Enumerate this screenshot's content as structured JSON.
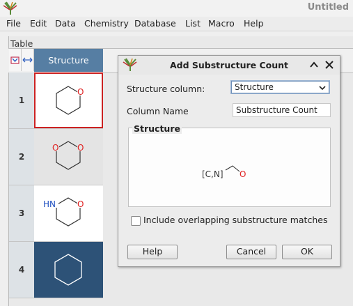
{
  "window": {
    "title": "Untitled"
  },
  "menu": [
    "File",
    "Edit",
    "Data",
    "Chemistry",
    "Database",
    "List",
    "Macro",
    "Help"
  ],
  "table": {
    "caption": "Table",
    "column_header": "Structure",
    "rows": [
      {
        "number": "1",
        "structure": "tetrahydropyran",
        "selected": true
      },
      {
        "number": "2",
        "structure": "1,3-dioxane",
        "selected": false
      },
      {
        "number": "3",
        "structure": "1,3-oxazinane",
        "atom_label_nh": "HN",
        "selected": false
      },
      {
        "number": "4",
        "structure": "cyclohexane",
        "highlighted": true
      }
    ],
    "atom_label_o": "O"
  },
  "dialog": {
    "title": "Add Substructure Count",
    "structure_column_label": "Structure column:",
    "structure_column_value": "Structure",
    "column_name_label": "Column Name",
    "column_name_value": "Substructure Count",
    "structure_group_label": "Structure",
    "query_atom_list": "[C,N]",
    "query_atom_o": "O",
    "overlap_checkbox_label": "Include overlapping substructure matches",
    "overlap_checked": false,
    "help_label": "Help",
    "cancel_label": "Cancel",
    "ok_label": "OK"
  },
  "colors": {
    "header_blue": "#567ea3",
    "selected_row_bg": "#2d5277",
    "selection_border": "#cc2222",
    "oxygen_red": "#e02020",
    "nitrogen_blue": "#2050c0"
  },
  "icons": [
    "app-logo-icon",
    "insert-row-icon",
    "resize-columns-icon",
    "collapse-chevron-icon",
    "close-icon",
    "dropdown-arrow-icon"
  ]
}
